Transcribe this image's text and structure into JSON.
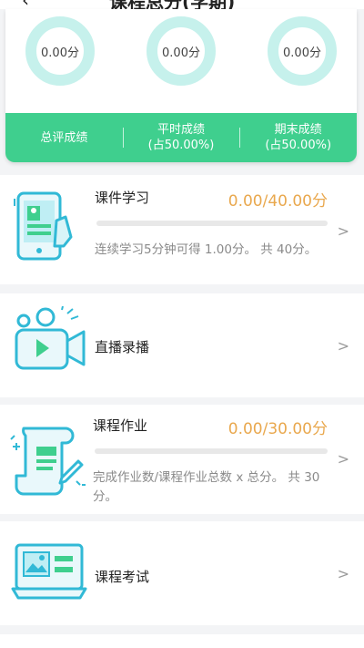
{
  "header": {
    "back_glyph": "‹",
    "title": "课程总分(学期)"
  },
  "summary": {
    "rings": [
      {
        "value": "0.00分"
      },
      {
        "value": "0.00分"
      },
      {
        "value": "0.00分"
      }
    ],
    "columns": [
      {
        "label": "总评成绩",
        "sub": ""
      },
      {
        "label": "平时成绩",
        "sub": "(占50.00%)"
      },
      {
        "label": "期末成绩",
        "sub": "(占50.00%)"
      }
    ]
  },
  "items": [
    {
      "name": "课件学习",
      "score": "0.00/40.00分",
      "progress": 0,
      "desc": "连续学习5分钟可得 1.00分。 共 40分。",
      "icon": "phone-courseware-icon"
    },
    {
      "name": "直播录播",
      "icon": "video-camera-icon"
    },
    {
      "name": "课程作业",
      "score": "0.00/30.00分",
      "progress": 0,
      "desc": "完成作业数/课程作业总数 x 总分。 共 30分。",
      "icon": "scroll-homework-icon"
    },
    {
      "name": "课程考试",
      "icon": "laptop-exam-icon"
    }
  ],
  "colors": {
    "accent": "#3fcf8e",
    "ring": "#c6f1ec",
    "score": "#e9a84e"
  }
}
